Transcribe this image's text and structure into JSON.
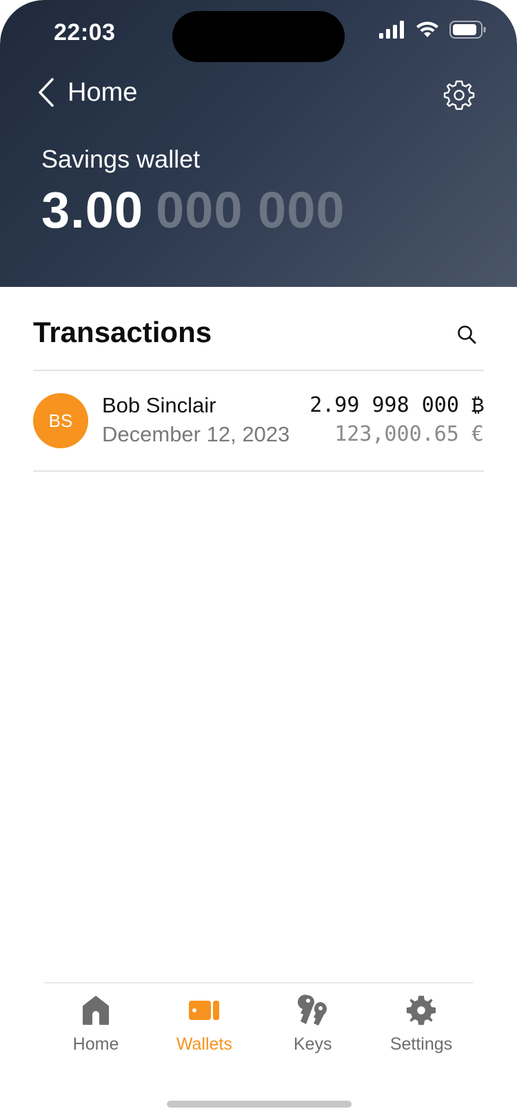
{
  "status_bar": {
    "time": "22:03"
  },
  "header": {
    "back_label": "Home",
    "wallet_name": "Savings wallet",
    "balance_main": "3.00",
    "balance_dim": "000 000"
  },
  "transactions": {
    "title": "Transactions",
    "items": [
      {
        "initials": "BS",
        "name": "Bob Sinclair",
        "date": "December 12, 2023",
        "amount_btc": "2.99 998 000 ₿",
        "amount_eur": "123,000.65 €"
      }
    ]
  },
  "tabbar": {
    "tabs": [
      {
        "label": "Home",
        "icon": "home-icon",
        "active": false
      },
      {
        "label": "Wallets",
        "icon": "wallet-icon",
        "active": true
      },
      {
        "label": "Keys",
        "icon": "keys-icon",
        "active": false
      },
      {
        "label": "Settings",
        "icon": "gear-icon",
        "active": false
      }
    ]
  },
  "colors": {
    "accent": "#f7931e",
    "header_dark": "#1f2a3b",
    "header_light": "#4a5569",
    "balance_dim": "#6b7482",
    "text_secondary": "#7a7a7a"
  }
}
